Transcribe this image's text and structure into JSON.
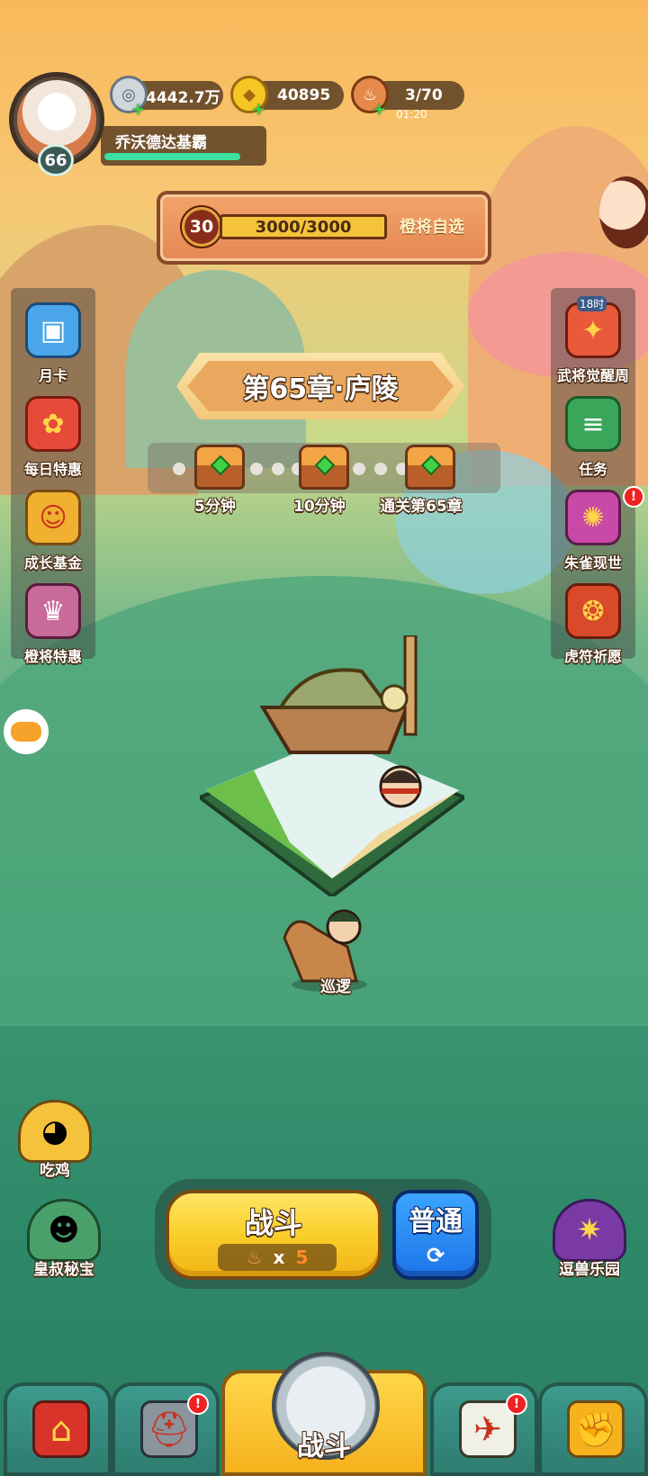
{
  "player": {
    "name": "乔沃德达基霸",
    "level": "66",
    "exp_fraction": 0.9
  },
  "resources": {
    "silver": {
      "value": "4442.7万",
      "icon": "silver-coin-icon"
    },
    "gold": {
      "value": "40895",
      "icon": "gold-ingot-icon"
    },
    "stamina": {
      "value": "3/70",
      "timer": "01:20",
      "icon": "drumstick-icon"
    }
  },
  "banner": {
    "level": "30",
    "progress": "3000/3000",
    "progress_fraction": 1.0,
    "action": "橙将自选"
  },
  "left_menu": [
    {
      "label": "月卡",
      "icon": "card-icon",
      "color": "#4aa6e8"
    },
    {
      "label": "每日特惠",
      "icon": "gift-bag-icon",
      "color": "#e84a3a"
    },
    {
      "label": "成长基金",
      "icon": "fund-icon",
      "color": "#f0b030"
    },
    {
      "label": "橙将特惠",
      "icon": "heroes-icon",
      "color": "#c86a9a"
    }
  ],
  "right_menu": [
    {
      "label": "武将觉醒周",
      "badge": "18时",
      "icon": "awaken-icon",
      "color": "#e85a3a"
    },
    {
      "label": "任务",
      "icon": "scroll-icon",
      "color": "#3aa65a"
    },
    {
      "label": "朱雀现世",
      "icon": "phoenix-icon",
      "color": "#c84aa6",
      "alert": "!"
    },
    {
      "label": "虎符祈愿",
      "icon": "tiger-seal-icon",
      "color": "#d84a2a"
    }
  ],
  "chapter": {
    "title": "第65章·庐陵",
    "chests": [
      {
        "label": "5分钟"
      },
      {
        "label": "10分钟"
      },
      {
        "label": "通关第65章"
      }
    ]
  },
  "hero": {
    "status": "巡逻"
  },
  "corner_left": [
    {
      "label": "吃鸡",
      "icon": "chicken-icon"
    },
    {
      "label": "皇叔秘宝",
      "icon": "treasure-icon"
    }
  ],
  "corner_right": {
    "label": "逗兽乐园",
    "icon": "beast-icon"
  },
  "fight": {
    "label": "战斗",
    "cost_x": "x",
    "cost_n": "5",
    "mode": "普通",
    "mode_icon": "⟳"
  },
  "nav": {
    "tabs": [
      {
        "icon": "city-gate-icon",
        "alert": ""
      },
      {
        "icon": "helmet-icon",
        "alert": "!"
      },
      {
        "icon": "swords-icon",
        "label": "战斗",
        "active": true
      },
      {
        "icon": "shoe-icon",
        "alert": "!"
      },
      {
        "icon": "fist-icon",
        "alert": ""
      }
    ]
  },
  "colors": {
    "accent_gold": "#f9cf2a",
    "accent_blue": "#1e74e8",
    "exp_green": "#3be0a0",
    "alert_red": "#e22222"
  }
}
